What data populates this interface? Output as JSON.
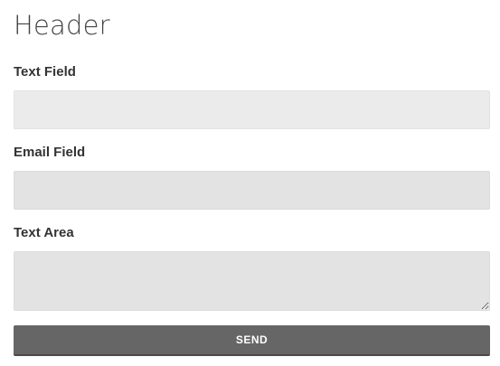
{
  "form": {
    "header": "Header",
    "text_field": {
      "label": "Text Field",
      "value": ""
    },
    "email_field": {
      "label": "Email Field",
      "value": ""
    },
    "text_area": {
      "label": "Text Area",
      "value": ""
    },
    "send_label": "SEND"
  },
  "colors": {
    "button_bg": "#666666",
    "field_bg": "#ebebeb",
    "text": "#333333"
  }
}
